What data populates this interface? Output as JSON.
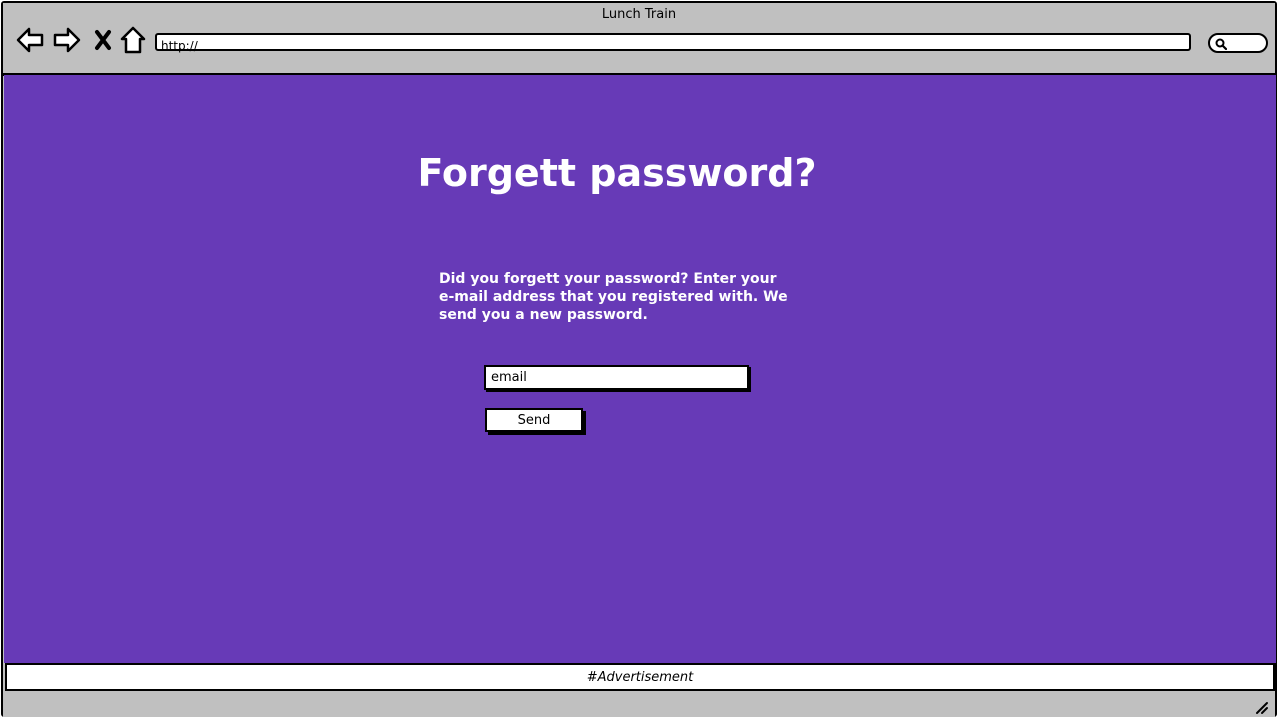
{
  "window": {
    "title": "Lunch Train"
  },
  "toolbar": {
    "icons": [
      "back-arrow-icon",
      "forward-arrow-icon",
      "close-x-icon",
      "home-icon"
    ],
    "address_value": "http://",
    "search_icon": "magnifier-icon"
  },
  "page": {
    "background_color": "#673ab7",
    "title": "Forgett password?",
    "instructions": "Did you forgett your password? Enter your e-mail address that you registered with. We send you a new password.",
    "email_placeholder": "email",
    "send_label": "Send"
  },
  "footer": {
    "advertisement": "#Advertisement"
  }
}
